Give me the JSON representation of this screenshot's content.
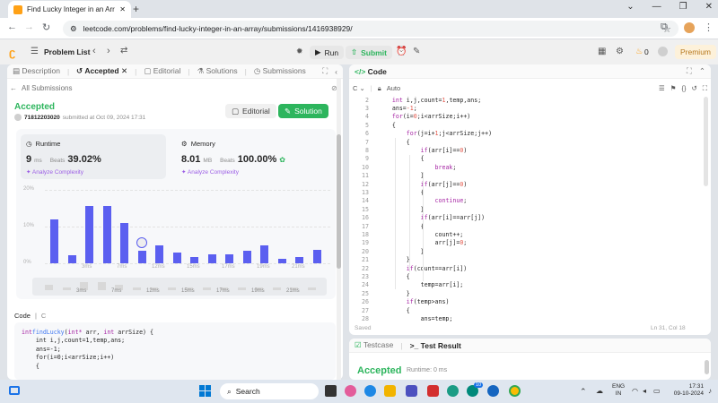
{
  "browser": {
    "tab_title": "Find Lucky Integer in an Array",
    "url": "leetcode.com/problems/find-lucky-integer-in-an-array/submissions/1416938929/"
  },
  "topbar": {
    "problem_list": "Problem List",
    "run": "Run",
    "submit": "Submit",
    "coins": "0",
    "premium": "Premium"
  },
  "left_tabs": [
    "Description",
    "Accepted",
    "Editorial",
    "Solutions",
    "Submissions"
  ],
  "submission": {
    "back": "All Submissions",
    "status": "Accepted",
    "user": "71812203020",
    "submitted_on": "submitted at Oct 09, 2024 17:31",
    "editorial_btn": "Editorial",
    "solution_btn": "Solution",
    "runtime": {
      "label": "Runtime",
      "value": "9",
      "unit": "ms",
      "beats_label": "Beats",
      "beats": "39.02%",
      "analyze": "Analyze Complexity"
    },
    "memory": {
      "label": "Memory",
      "value": "8.01",
      "unit": "MB",
      "beats_label": "Beats",
      "beats": "100.00%",
      "analyze": "Analyze Complexity"
    },
    "code_label": "Code",
    "lang": "C"
  },
  "chart_data": {
    "type": "bar",
    "ytick_labels": [
      "20%",
      "10%",
      "0%"
    ],
    "ylim": [
      0,
      20
    ],
    "values": [
      12,
      2.2,
      15.5,
      15.5,
      11,
      3.5,
      5,
      3,
      1.6,
      2.5,
      2.5,
      3.5,
      5,
      1.2,
      1.6,
      3.6
    ],
    "xtick_labels": [
      "3ms",
      "7ms",
      "12ms",
      "15ms",
      "17ms",
      "19ms",
      "21ms"
    ],
    "overview_values": [
      2,
      1,
      3,
      3,
      2,
      1,
      1,
      1,
      1,
      1,
      1,
      1,
      1,
      1,
      1,
      1
    ],
    "overview_labels": [
      "3ms",
      "7ms",
      "12ms",
      "15ms",
      "17ms",
      "19ms",
      "21ms"
    ],
    "bar_color": "#5b5ff0"
  },
  "left_code": [
    "int findLucky(int* arr, int arrSize) {",
    "    int i,j,count=1,temp,ans;",
    "    ans=-1;",
    "    for(i=0;i<arrSize;i++)",
    "    {"
  ],
  "editor": {
    "title": "Code",
    "lang": "C",
    "mode": "Auto",
    "status": "Saved",
    "cursor": "Ln 31, Col 18",
    "line_numbers": [
      "2",
      "3",
      "4",
      "5",
      "6",
      "7",
      "8",
      "9",
      "10",
      "11",
      "12",
      "13",
      "14",
      "15",
      "16",
      "17",
      "18",
      "19",
      "20",
      "21",
      "22",
      "23",
      "24",
      "25",
      "26",
      "27",
      "28"
    ],
    "lines": [
      "    int i,j,count=1,temp,ans;",
      "    ans=-1;",
      "    for(i=0;i<arrSize;i++)",
      "    {",
      "        for(j=i+1;j<arrSize;j++)",
      "        {",
      "            if(arr[i]==0)",
      "            {",
      "                break;",
      "            }",
      "            if(arr[j]==0)",
      "            {",
      "                continue;",
      "            }",
      "            if(arr[i]==arr[j])",
      "            {",
      "                count++;",
      "                arr[j]=0;",
      "            }",
      "        }",
      "        if(count==arr[i])",
      "        {",
      "            temp=arr[i];",
      "        }",
      "        if(temp>ans)",
      "        {",
      "            ans=temp;"
    ]
  },
  "testcase": {
    "tab1": "Testcase",
    "tab2": "Test Result",
    "status": "Accepted",
    "runtime": "Runtime: 0 ms"
  },
  "taskbar": {
    "search": "Search",
    "lang1": "ENG",
    "lang2": "IN",
    "time": "17:31",
    "date": "09-10-2024",
    "badge": "10"
  }
}
